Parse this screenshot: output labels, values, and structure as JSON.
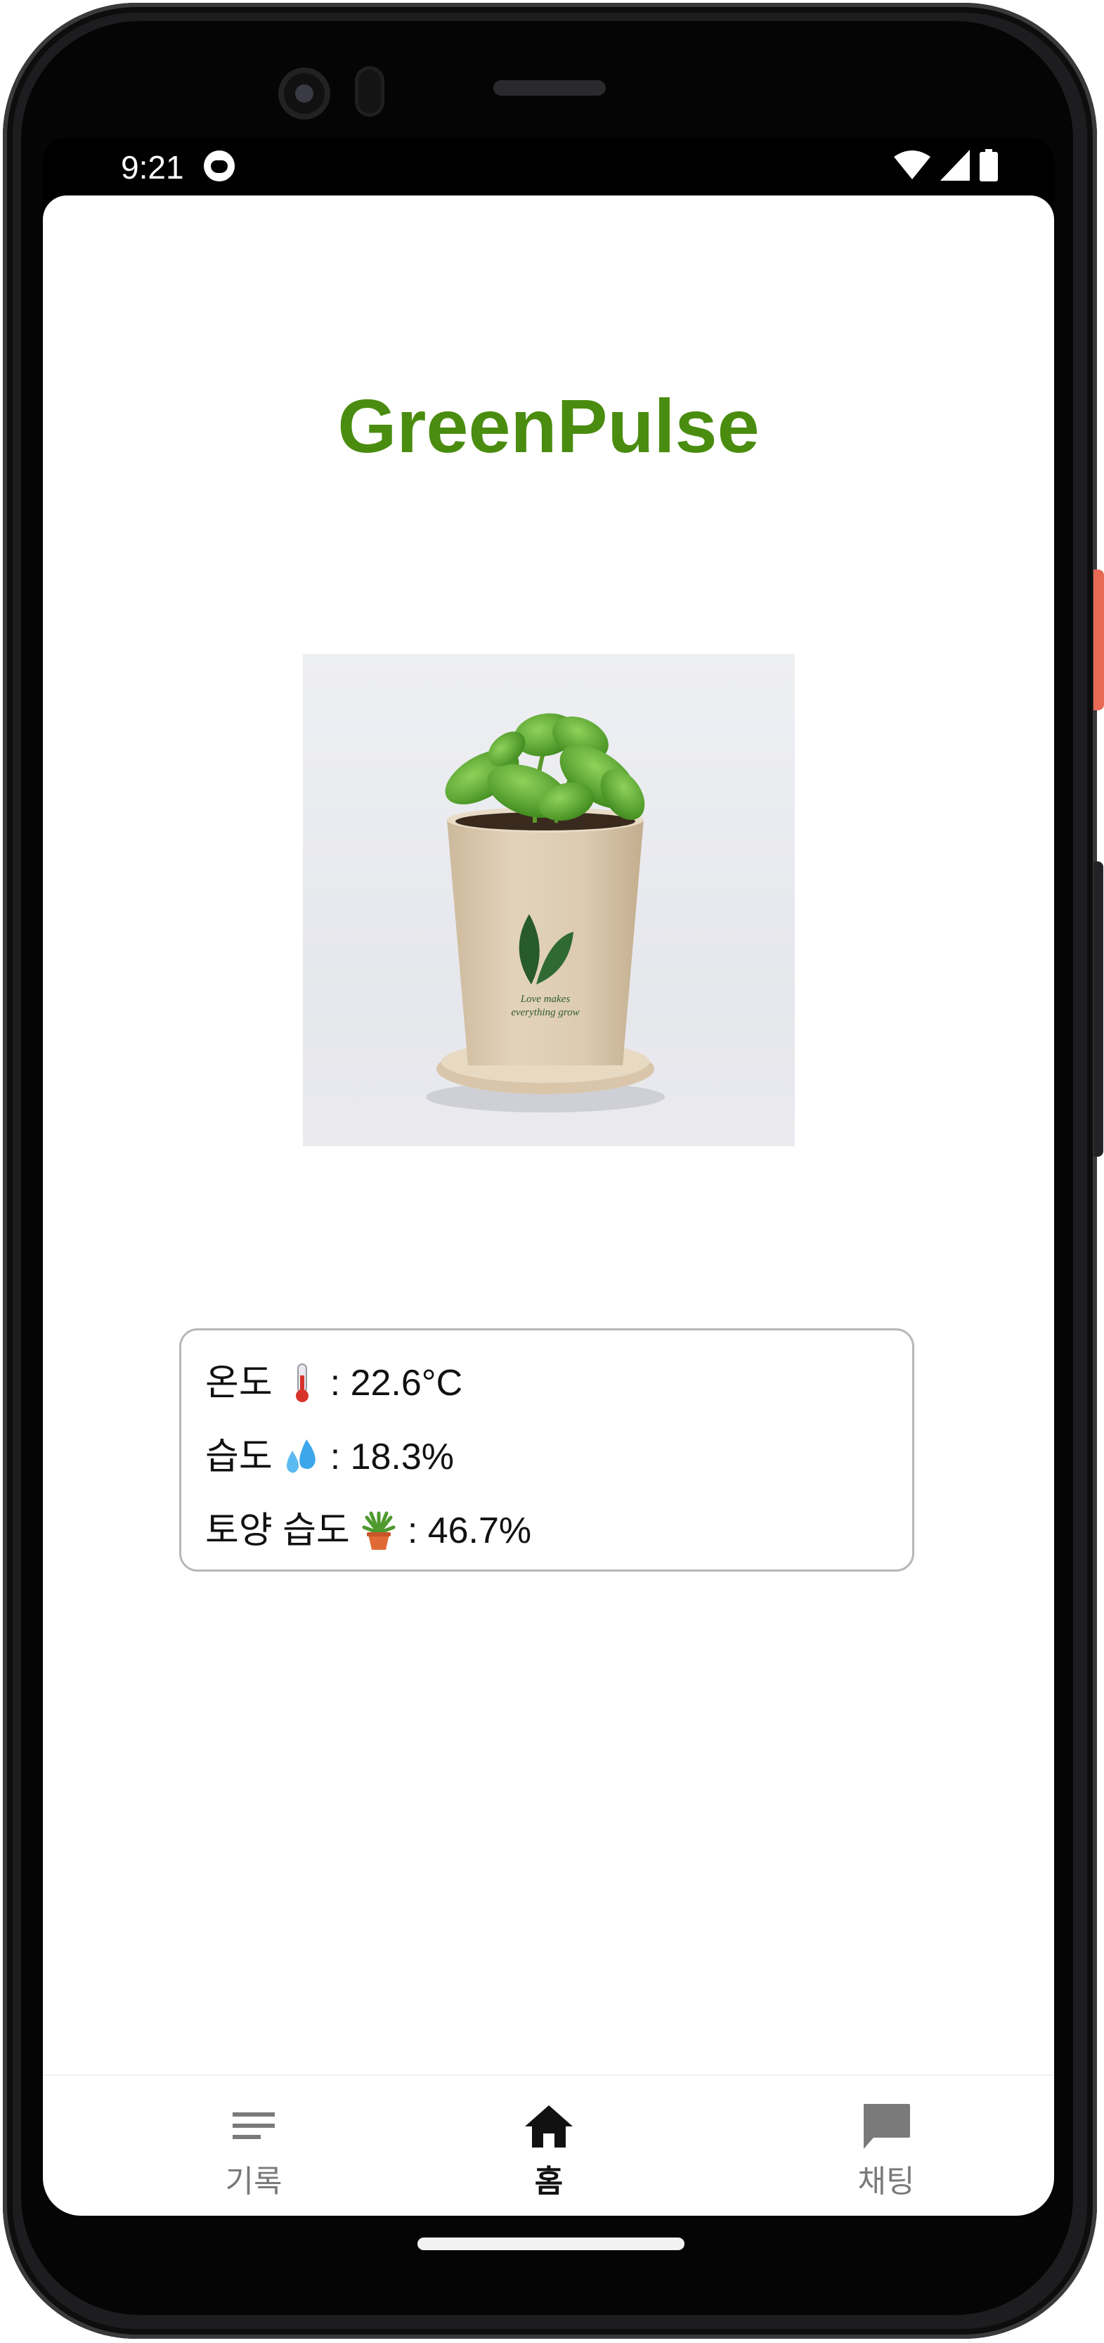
{
  "status_bar": {
    "time": "9:21"
  },
  "app": {
    "title": "GreenPulse"
  },
  "plant_image": {
    "pot_text_line1": "Love makes",
    "pot_text_line2": "everything grow"
  },
  "sensors": [
    {
      "label": "온도",
      "emoji": "thermometer-icon",
      "value": ": 22.6°C"
    },
    {
      "label": "습도",
      "emoji": "sweat-droplets-icon",
      "value": ": 18.3%"
    },
    {
      "label": "토양 습도",
      "emoji": "potted-plant-icon",
      "value": ": 46.7%"
    }
  ],
  "bottom_nav": {
    "items": [
      {
        "label": "기록",
        "icon": "list-icon",
        "active": false
      },
      {
        "label": "홈",
        "icon": "home-icon",
        "active": true
      },
      {
        "label": "채팅",
        "icon": "chat-icon",
        "active": false
      }
    ]
  },
  "colors": {
    "title_green": "#4a8c0f",
    "inactive_nav": "#7a7a7a",
    "active_nav": "#111111",
    "card_border": "#b7b7b7"
  }
}
